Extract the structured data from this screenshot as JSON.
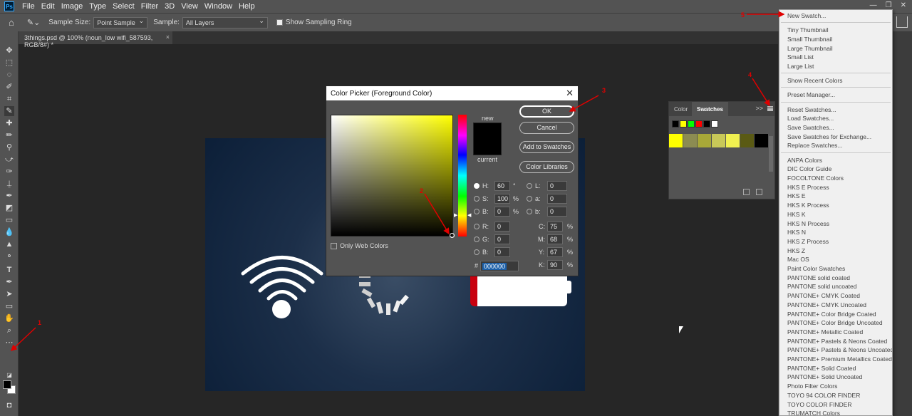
{
  "app": {
    "logo": "Ps",
    "menu": [
      "File",
      "Edit",
      "Image",
      "Type",
      "Select",
      "Filter",
      "3D",
      "View",
      "Window",
      "Help"
    ]
  },
  "options_bar": {
    "sample_size_label": "Sample Size:",
    "sample_size_value": "Point Sample",
    "sample_label": "Sample:",
    "sample_value": "All Layers",
    "show_ring_label": "Show Sampling Ring",
    "show_ring_checked": true
  },
  "document_tab": {
    "title": "3things.psd @ 100% (noun_low wifi_587593, RGB/8#) *",
    "close": "×"
  },
  "color_picker": {
    "title": "Color Picker (Foreground Color)",
    "close": "✕",
    "new_label": "new",
    "current_label": "current",
    "buttons": {
      "ok": "OK",
      "cancel": "Cancel",
      "add_to_swatches": "Add to Swatches",
      "color_libraries": "Color Libraries"
    },
    "only_web_colors": "Only Web Colors",
    "hsb": {
      "h_label": "H:",
      "h": "60",
      "h_unit": "°",
      "s_label": "S:",
      "s": "100",
      "s_unit": "%",
      "b_label": "B:",
      "b": "0",
      "b_unit": "%"
    },
    "rgb": {
      "r_label": "R:",
      "r": "0",
      "g_label": "G:",
      "g": "0",
      "b_label": "B:",
      "b": "0"
    },
    "lab": {
      "l_label": "L:",
      "l": "0",
      "a_label": "a:",
      "a": "0",
      "b_label": "b:",
      "b": "0"
    },
    "cmyk": {
      "c_label": "C:",
      "c": "75",
      "m_label": "M:",
      "m": "68",
      "y_label": "Y:",
      "y": "67",
      "k_label": "K:",
      "k": "90",
      "unit": "%"
    },
    "hex_label": "#",
    "hex": "000000"
  },
  "swatches_panel": {
    "tab_color": "Color",
    "tab_swatches": "Swatches",
    "expand": ">>",
    "recent_colors": [
      "#000000",
      "#ffff00",
      "#00ff00",
      "#ff0000",
      "#000000",
      "#ffffff"
    ],
    "swatches": [
      "#ffff00",
      "#8c8c52",
      "#a8a838",
      "#c8c858",
      "#f0f050",
      "#5a5a14",
      "#000000"
    ]
  },
  "flyout_menu": {
    "groups": [
      [
        "New Swatch..."
      ],
      [
        "Tiny Thumbnail",
        "Small Thumbnail",
        "Large Thumbnail",
        "Small List",
        "Large List"
      ],
      [
        "Show Recent Colors"
      ],
      [
        "Preset Manager..."
      ],
      [
        "Reset Swatches...",
        "Load Swatches...",
        "Save Swatches...",
        "Save Swatches for Exchange...",
        "Replace Swatches..."
      ],
      [
        "ANPA Colors",
        "DIC Color Guide",
        "FOCOLTONE Colors",
        "HKS E Process",
        "HKS E",
        "HKS K Process",
        "HKS K",
        "HKS N Process",
        "HKS N",
        "HKS Z Process",
        "HKS Z",
        "Mac OS",
        "Paint Color Swatches",
        "PANTONE solid coated",
        "PANTONE solid uncoated",
        "PANTONE+ CMYK Coated",
        "PANTONE+ CMYK Uncoated",
        "PANTONE+ Color Bridge Coated",
        "PANTONE+ Color Bridge Uncoated",
        "PANTONE+ Metallic Coated",
        "PANTONE+ Pastels & Neons Coated",
        "PANTONE+ Pastels & Neons Uncoated",
        "PANTONE+ Premium Metallics Coated",
        "PANTONE+ Solid Coated",
        "PANTONE+ Solid Uncoated",
        "Photo Filter Colors",
        "TOYO 94 COLOR FINDER",
        "TOYO COLOR FINDER",
        "TRUMATCH Colors"
      ]
    ]
  },
  "annotations": [
    "1",
    "2",
    "3",
    "4",
    "5"
  ],
  "colors": {
    "annotation": "#e00000",
    "accent_selection": "#1b5fa8"
  }
}
